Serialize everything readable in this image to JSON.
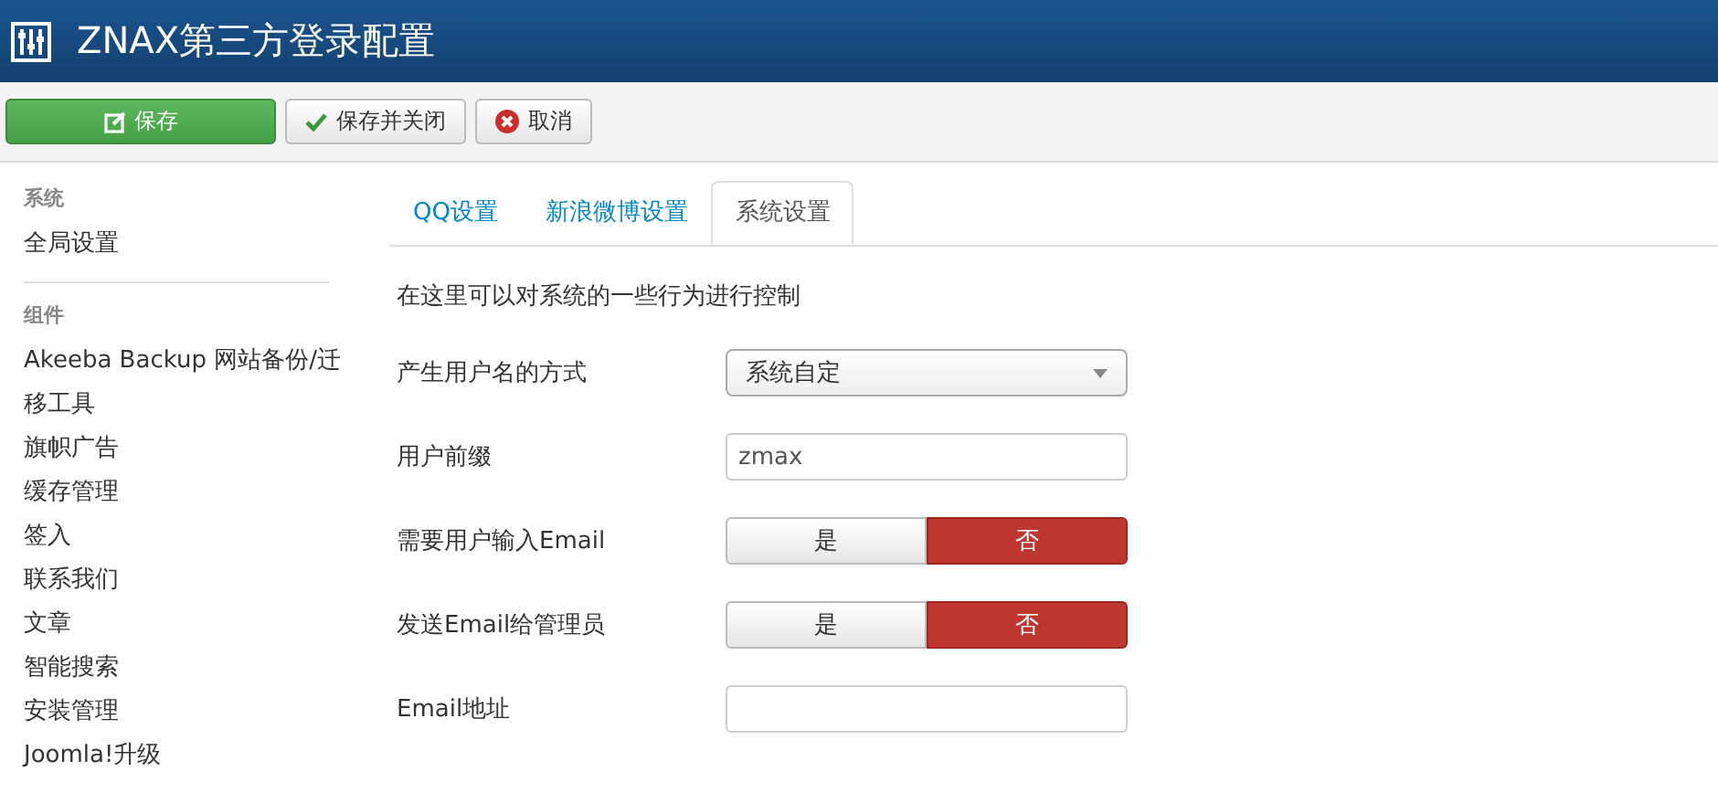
{
  "header": {
    "title": "ZNAX第三方登录配置"
  },
  "toolbar": [
    {
      "label": "保存",
      "kind": "primary"
    },
    {
      "label": "保存并关闭",
      "kind": "check"
    },
    {
      "label": "取消",
      "kind": "cancel"
    }
  ],
  "sidebar": {
    "sections": [
      {
        "heading": "系统",
        "items": [
          "全局设置"
        ]
      },
      {
        "heading": "组件",
        "items": [
          "Akeeba Backup 网站备份/迁移工具",
          "旗帜广告",
          "缓存管理",
          "签入",
          "联系我们",
          "文章",
          "智能搜索",
          "安装管理",
          "Joomla!升级"
        ]
      }
    ]
  },
  "tabs": [
    {
      "label": "QQ设置",
      "selected": false
    },
    {
      "label": "新浪微博设置",
      "selected": false
    },
    {
      "label": "系统设置",
      "selected": true
    }
  ],
  "description": "在这里可以对系统的一些行为进行控制",
  "fields": [
    {
      "label": "产生用户名的方式",
      "kind": "select",
      "value": "系统自定"
    },
    {
      "label": "用户前缀",
      "kind": "text",
      "value": "zmax"
    },
    {
      "label": "需要用户输入Email",
      "kind": "toggle",
      "options": [
        {
          "label": "是",
          "selected": false
        },
        {
          "label": "否",
          "selected": true
        }
      ]
    },
    {
      "label": "发送Email给管理员",
      "kind": "toggle",
      "options": [
        {
          "label": "是",
          "selected": false
        },
        {
          "label": "否",
          "selected": true
        }
      ]
    },
    {
      "label": "Email地址",
      "kind": "text"
    }
  ]
}
